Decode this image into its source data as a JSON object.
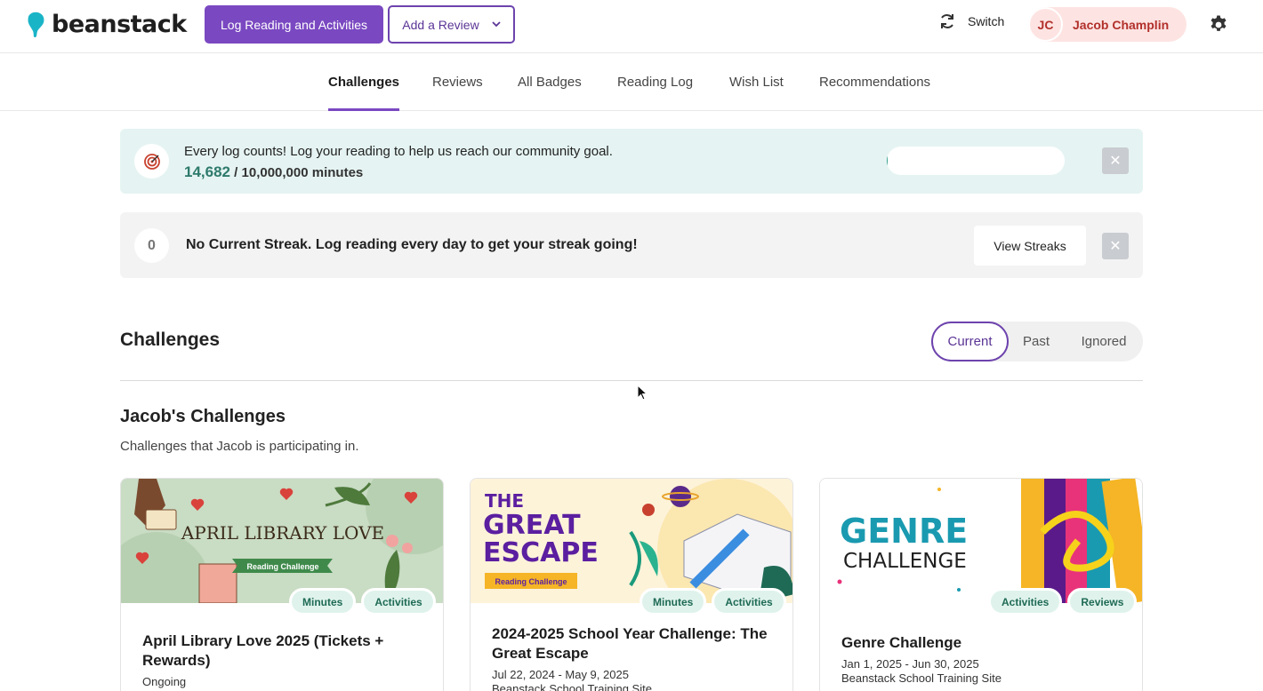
{
  "header": {
    "logo_text": "beanstack",
    "log_button": "Log Reading and Activities",
    "review_button": "Add a Review",
    "switch_label": "Switch",
    "user_initials": "JC",
    "user_name": "Jacob Champlin",
    "brand_color": "#7a48c1"
  },
  "nav": {
    "tabs": [
      "Challenges",
      "Reviews",
      "All Badges",
      "Reading Log",
      "Wish List",
      "Recommendations"
    ],
    "active": "Challenges"
  },
  "goal_banner": {
    "message": "Every log counts! Log your reading to help us reach our community goal.",
    "current": "14,682",
    "total": "/ 10,000,000 minutes",
    "progress_fraction": 0.0015
  },
  "streak_banner": {
    "count": "0",
    "message": "No Current Streak. Log reading every day to get your streak going!",
    "button": "View Streaks"
  },
  "challenges": {
    "title": "Challenges",
    "filters": [
      "Current",
      "Past",
      "Ignored"
    ],
    "active_filter": "Current",
    "subtitle": "Jacob's Challenges",
    "description": "Challenges that Jacob is participating in."
  },
  "cards": [
    {
      "banner_title": "APRIL LIBRARY LOVE",
      "banner_ribbon": "Reading Challenge",
      "tags": [
        "Minutes",
        "Activities"
      ],
      "title": "April Library Love 2025 (Tickets + Rewards)",
      "date": "Ongoing",
      "site": ""
    },
    {
      "banner_title_1": "THE",
      "banner_title_2": "GREAT",
      "banner_title_3": "ESCAPE",
      "banner_ribbon": "Reading Challenge",
      "tags": [
        "Minutes",
        "Activities"
      ],
      "title": "2024-2025 School Year Challenge: The Great Escape",
      "date": "Jul 22, 2024 - May 9, 2025",
      "site": "Beanstack School Training Site"
    },
    {
      "banner_title_1": "GENRE",
      "banner_title_2": "CHALLENGE",
      "tags": [
        "Activities",
        "Reviews"
      ],
      "title": "Genre Challenge",
      "date": "Jan 1, 2025 - Jun 30, 2025",
      "site": "Beanstack School Training Site"
    }
  ]
}
